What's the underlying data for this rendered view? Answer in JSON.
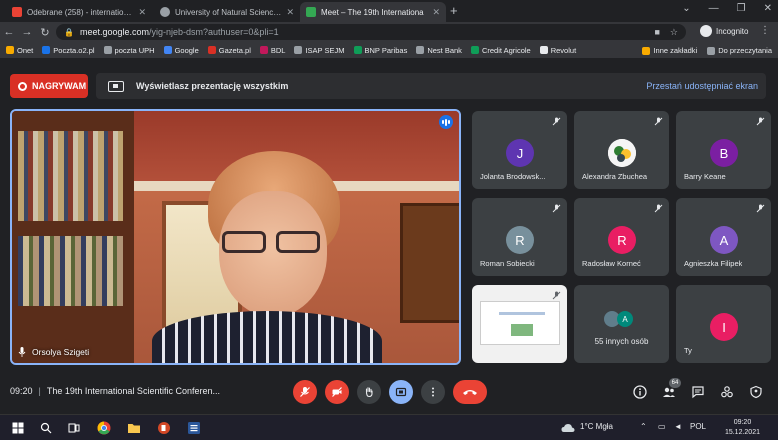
{
  "browser": {
    "tabs": [
      {
        "label": "Odebrane (258) - international.u",
        "color": "#ea4335"
      },
      {
        "label": "University of Natural Sciences an",
        "color": "#5f6368"
      },
      {
        "label": "Meet – The 19th Internationa",
        "color": "#34a853"
      }
    ],
    "new_tab": "+",
    "url_host": "meet.google.com",
    "url_path": "/yig-njeb-dsm?authuser=0&pli=1",
    "profile": "Incognito",
    "bookmarks": [
      {
        "label": "Onet",
        "color": "#f9ab00"
      },
      {
        "label": "Poczta.o2.pl",
        "color": "#1a73e8"
      },
      {
        "label": "poczta UPH",
        "color": "#9aa0a6"
      },
      {
        "label": "Google",
        "color": "#4285f4"
      },
      {
        "label": "Gazeta.pl",
        "color": "#d93025"
      },
      {
        "label": "BDL",
        "color": "#c2185b"
      },
      {
        "label": "ISAP SEJM",
        "color": "#9aa0a6"
      },
      {
        "label": "BNP Paribas",
        "color": "#0f9d58"
      },
      {
        "label": "Nest Bank",
        "color": "#9aa0a6"
      },
      {
        "label": "Credit Agricole",
        "color": "#0f9d58"
      },
      {
        "label": "Revolut",
        "color": "#e8eaed"
      }
    ],
    "bookmarks_right": [
      "Inne zakładki",
      "Do przeczytania"
    ]
  },
  "meet": {
    "recording_label": "NAGRYWAM",
    "presenting_text": "Wyświetlasz prezentację wszystkim",
    "stop_sharing": "Przestań udostępniać ekran",
    "speaker_name": "Orsolya Szigeti",
    "participants": [
      {
        "name": "Jolanta Brodowsk...",
        "initial": "J",
        "color": "#5e35b1"
      },
      {
        "name": "Alexandra Zbuchea",
        "initial": "",
        "color": "#f5f5f5"
      },
      {
        "name": "Barry Keane",
        "initial": "B",
        "color": "#7b1fa2"
      },
      {
        "name": "Roman Sobiecki",
        "initial": "R",
        "color": "#78909c"
      },
      {
        "name": "Radosław Korneć",
        "initial": "R",
        "color": "#e91e63"
      },
      {
        "name": "Agnieszka Filipek",
        "initial": "A",
        "color": "#7e57c2"
      }
    ],
    "more_label": "55 innych osób",
    "more_initial": "A",
    "self_name": "Ty",
    "self_initial": "I",
    "time": "09:20",
    "meeting_title": "The 19th International Scientific Conferen...",
    "people_count": "64",
    "colors": {
      "accent": "#8ab4f8",
      "red": "#ea4335"
    }
  },
  "taskbar": {
    "weather": "1°C  Mgła",
    "lang": "POL",
    "clock_time": "09:20",
    "clock_date": "15.12.2021"
  }
}
